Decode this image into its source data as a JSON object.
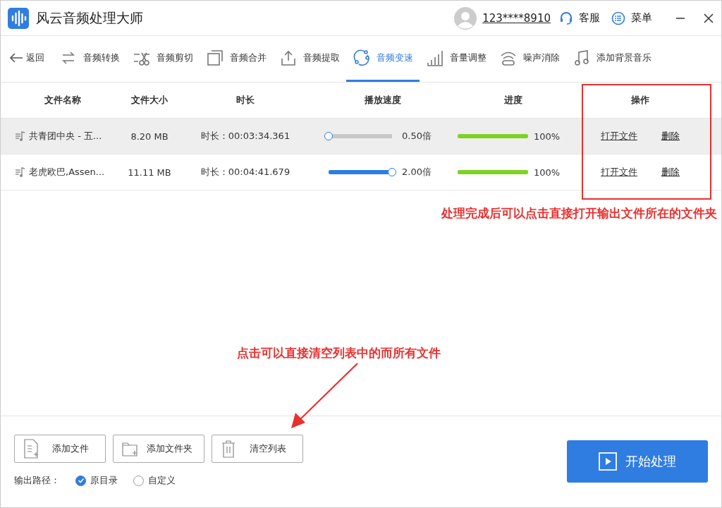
{
  "window": {
    "title": "风云音频处理大师",
    "account": "123****8910",
    "service": "客服",
    "menu": "菜单"
  },
  "toolbar": {
    "back": "返回",
    "tabs": [
      {
        "label": "音频转换",
        "selected": false
      },
      {
        "label": "音频剪切",
        "selected": false
      },
      {
        "label": "音频合并",
        "selected": false
      },
      {
        "label": "音频提取",
        "selected": false
      },
      {
        "label": "音频变速",
        "selected": true
      },
      {
        "label": "音量调整",
        "selected": false
      },
      {
        "label": "噪声消除",
        "selected": false
      },
      {
        "label": "添加背景音乐",
        "selected": false
      }
    ]
  },
  "table": {
    "columns": [
      "文件名称",
      "文件大小",
      "时长",
      "播放速度",
      "进度",
      "操作"
    ],
    "rows": [
      {
        "name": "共青团中央 - 五...",
        "size": "8.20 MB",
        "duration": "时长：00:03:34.361",
        "speed": {
          "level": 0,
          "reading": "0.50倍"
        },
        "progress": {
          "level": 1,
          "reading": "100%"
        },
        "open": "打开文件",
        "delete": "删除",
        "selected": true
      },
      {
        "name": "老虎欧巴,Assen...",
        "size": "11.11 MB",
        "duration": "时长：00:04:41.679",
        "speed": {
          "level": 1,
          "reading": "2.00倍"
        },
        "progress": {
          "level": 1,
          "reading": "100%"
        },
        "open": "打开文件",
        "delete": "删除",
        "selected": false
      }
    ]
  },
  "annotations": [
    "处理完成后可以点击直接打开输出文件所在的文件夹",
    "点击可以直接清空列表中的而所有文件"
  ],
  "actions": [
    {
      "label": "添加文件"
    },
    {
      "label": "添加文件夹"
    },
    {
      "label": "清空列表"
    }
  ],
  "output": {
    "label": "输出路径：",
    "options": [
      {
        "label": "原目录",
        "selected": true
      },
      {
        "label": "自定义",
        "selected": false
      }
    ]
  },
  "start_button": "开始处理"
}
